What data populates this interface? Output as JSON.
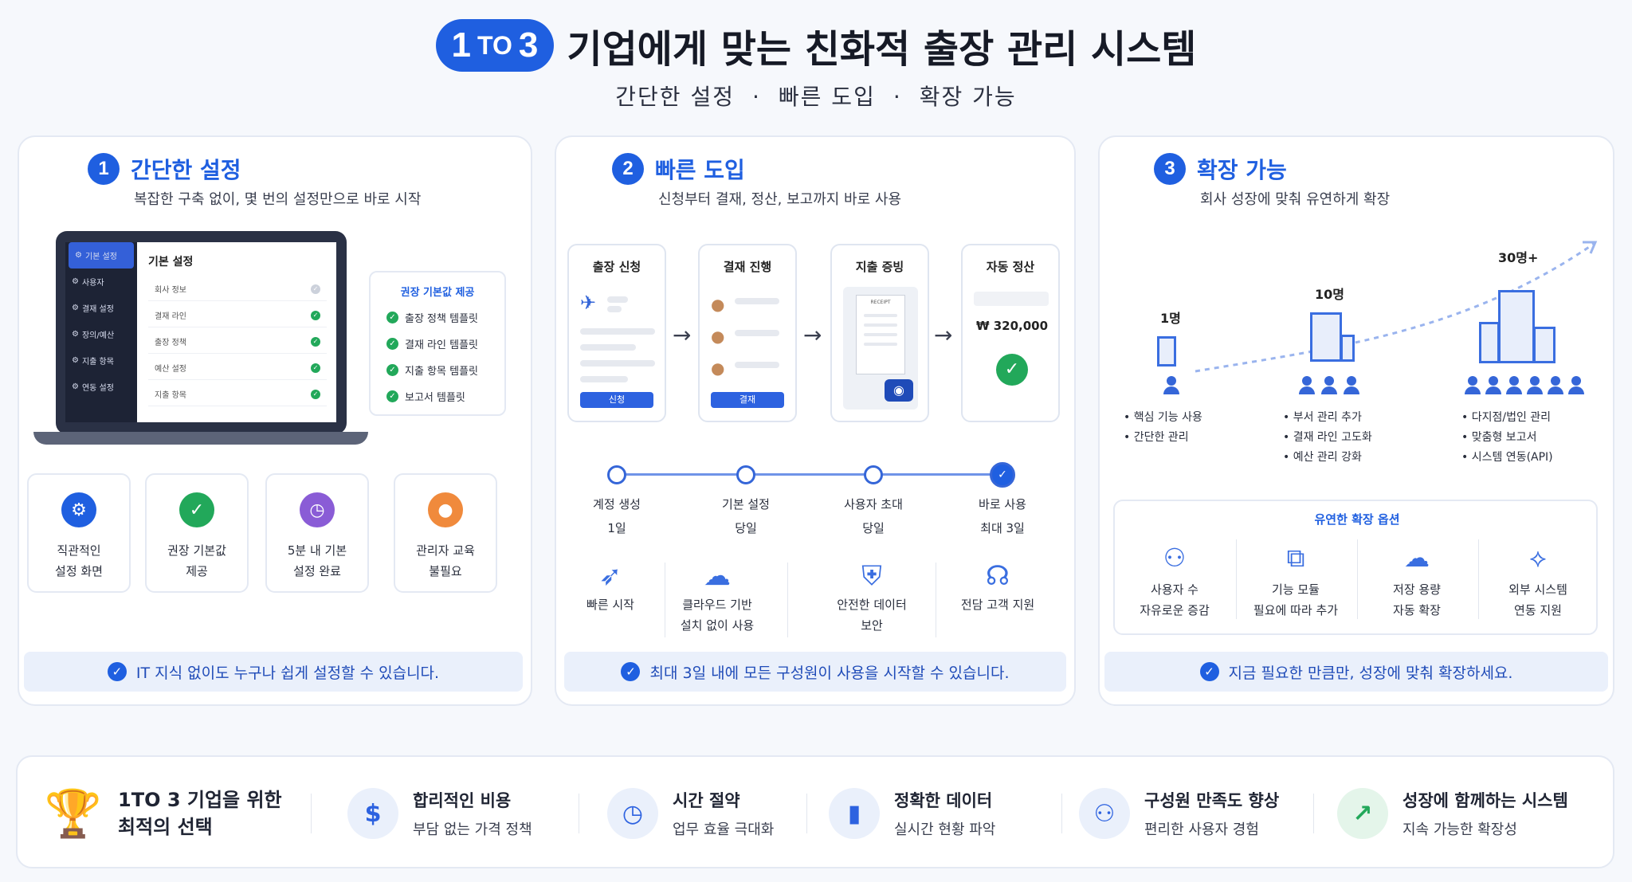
{
  "header": {
    "badge_main": "1",
    "badge_small": "TO",
    "badge_end": "3",
    "title": "기업에게 맞는 친화적 출장 관리 시스템",
    "sub1": "간단한 설정",
    "sub2": "빠른 도입",
    "sub3": "확장 가능",
    "dot": "·"
  },
  "section1": {
    "num": "1",
    "title": "간단한 설정",
    "desc": "복잡한 구축 없이, 몇 번의 설정만으로 바로 시작",
    "laptop": {
      "side": [
        "기본 설정",
        "사용자",
        "결재 설정",
        "장의/예산",
        "지출 항목",
        "연동 설정"
      ],
      "main_title": "기본 설정",
      "rows": [
        "회사 정보",
        "결재 라인",
        "출장 정책",
        "예산 설정",
        "지출 항목"
      ]
    },
    "templates": {
      "title": "권장 기본값 제공",
      "items": [
        "출장 정책 템플릿",
        "결재 라인 템플릿",
        "지출 항목 템플릿",
        "보고서 템플릿"
      ]
    },
    "features": [
      {
        "l1": "직관적인",
        "l2": "설정 화면"
      },
      {
        "l1": "권장 기본값",
        "l2": "제공"
      },
      {
        "l1": "5분 내 기본",
        "l2": "설정 완료"
      },
      {
        "l1": "관리자 교육",
        "l2": "불필요"
      }
    ],
    "footer": "IT 지식 없이도 누구나 쉽게 설정할 수 있습니다."
  },
  "section2": {
    "num": "2",
    "title": "빠른 도입",
    "desc": "신청부터 결재, 정산, 보고까지 바로 사용",
    "steps": [
      {
        "title": "출장 신청",
        "btn": "신청"
      },
      {
        "title": "결재 진행",
        "btn": "결재"
      },
      {
        "title": "지출 증빙",
        "btn": ""
      },
      {
        "title": "자동 정산",
        "btn": "",
        "amount": "₩ 320,000"
      }
    ],
    "receipt_label": "RECEIPT",
    "timeline": [
      {
        "label": "계정 생성",
        "time": "1일"
      },
      {
        "label": "기본 설정",
        "time": "당일"
      },
      {
        "label": "사용자 초대",
        "time": "당일"
      },
      {
        "label": "바로 사용",
        "time": "최대 3일"
      }
    ],
    "benefits": [
      {
        "l1": "빠른 시작",
        "l2": ""
      },
      {
        "l1": "클라우드 기반",
        "l2": "설치 없이 사용"
      },
      {
        "l1": "안전한 데이터",
        "l2": "보안"
      },
      {
        "l1": "전담 고객 지원",
        "l2": ""
      }
    ],
    "footer": "최대 3일 내에 모든 구성원이 사용을 시작할 수 있습니다."
  },
  "section3": {
    "num": "3",
    "title": "확장 가능",
    "desc": "회사 성장에 맞춰 유연하게 확장",
    "stages": [
      {
        "count": "1명",
        "bullets": [
          "핵심 기능 사용",
          "간단한 관리"
        ]
      },
      {
        "count": "10명",
        "bullets": [
          "부서 관리 추가",
          "결재 라인 고도화",
          "예산 관리 강화"
        ]
      },
      {
        "count": "30명+",
        "bullets": [
          "다지점/법인 관리",
          "맞춤형 보고서",
          "시스템 연동(API)"
        ]
      }
    ],
    "options_title": "유연한 확장 옵션",
    "options": [
      {
        "l1": "사용자 수",
        "l2": "자유로운 증감"
      },
      {
        "l1": "기능 모듈",
        "l2": "필요에 따라 추가"
      },
      {
        "l1": "저장 용량",
        "l2": "자동 확장"
      },
      {
        "l1": "외부 시스템",
        "l2": "연동 지원"
      }
    ],
    "footer": "지금 필요한 만큼만, 성장에 맞춰 확장하세요."
  },
  "bottom": {
    "lead1": "1TO 3 기업을 위한",
    "lead2": "최적의 선택",
    "items": [
      {
        "a": "합리적인 비용",
        "b": "부담 없는 가격 정책"
      },
      {
        "a": "시간 절약",
        "b": "업무 효율 극대화"
      },
      {
        "a": "정확한 데이터",
        "b": "실시간 현황 파악"
      },
      {
        "a": "구성원 만족도 향상",
        "b": "편리한 사용자 경험"
      },
      {
        "a": "성장에 함께하는 시스템",
        "b": "지속 가능한 확장성"
      }
    ]
  },
  "colors": {
    "accent": "#1f5fe0",
    "success": "#22a85a",
    "purple": "#8a5cd6",
    "orange": "#f08a3c"
  }
}
